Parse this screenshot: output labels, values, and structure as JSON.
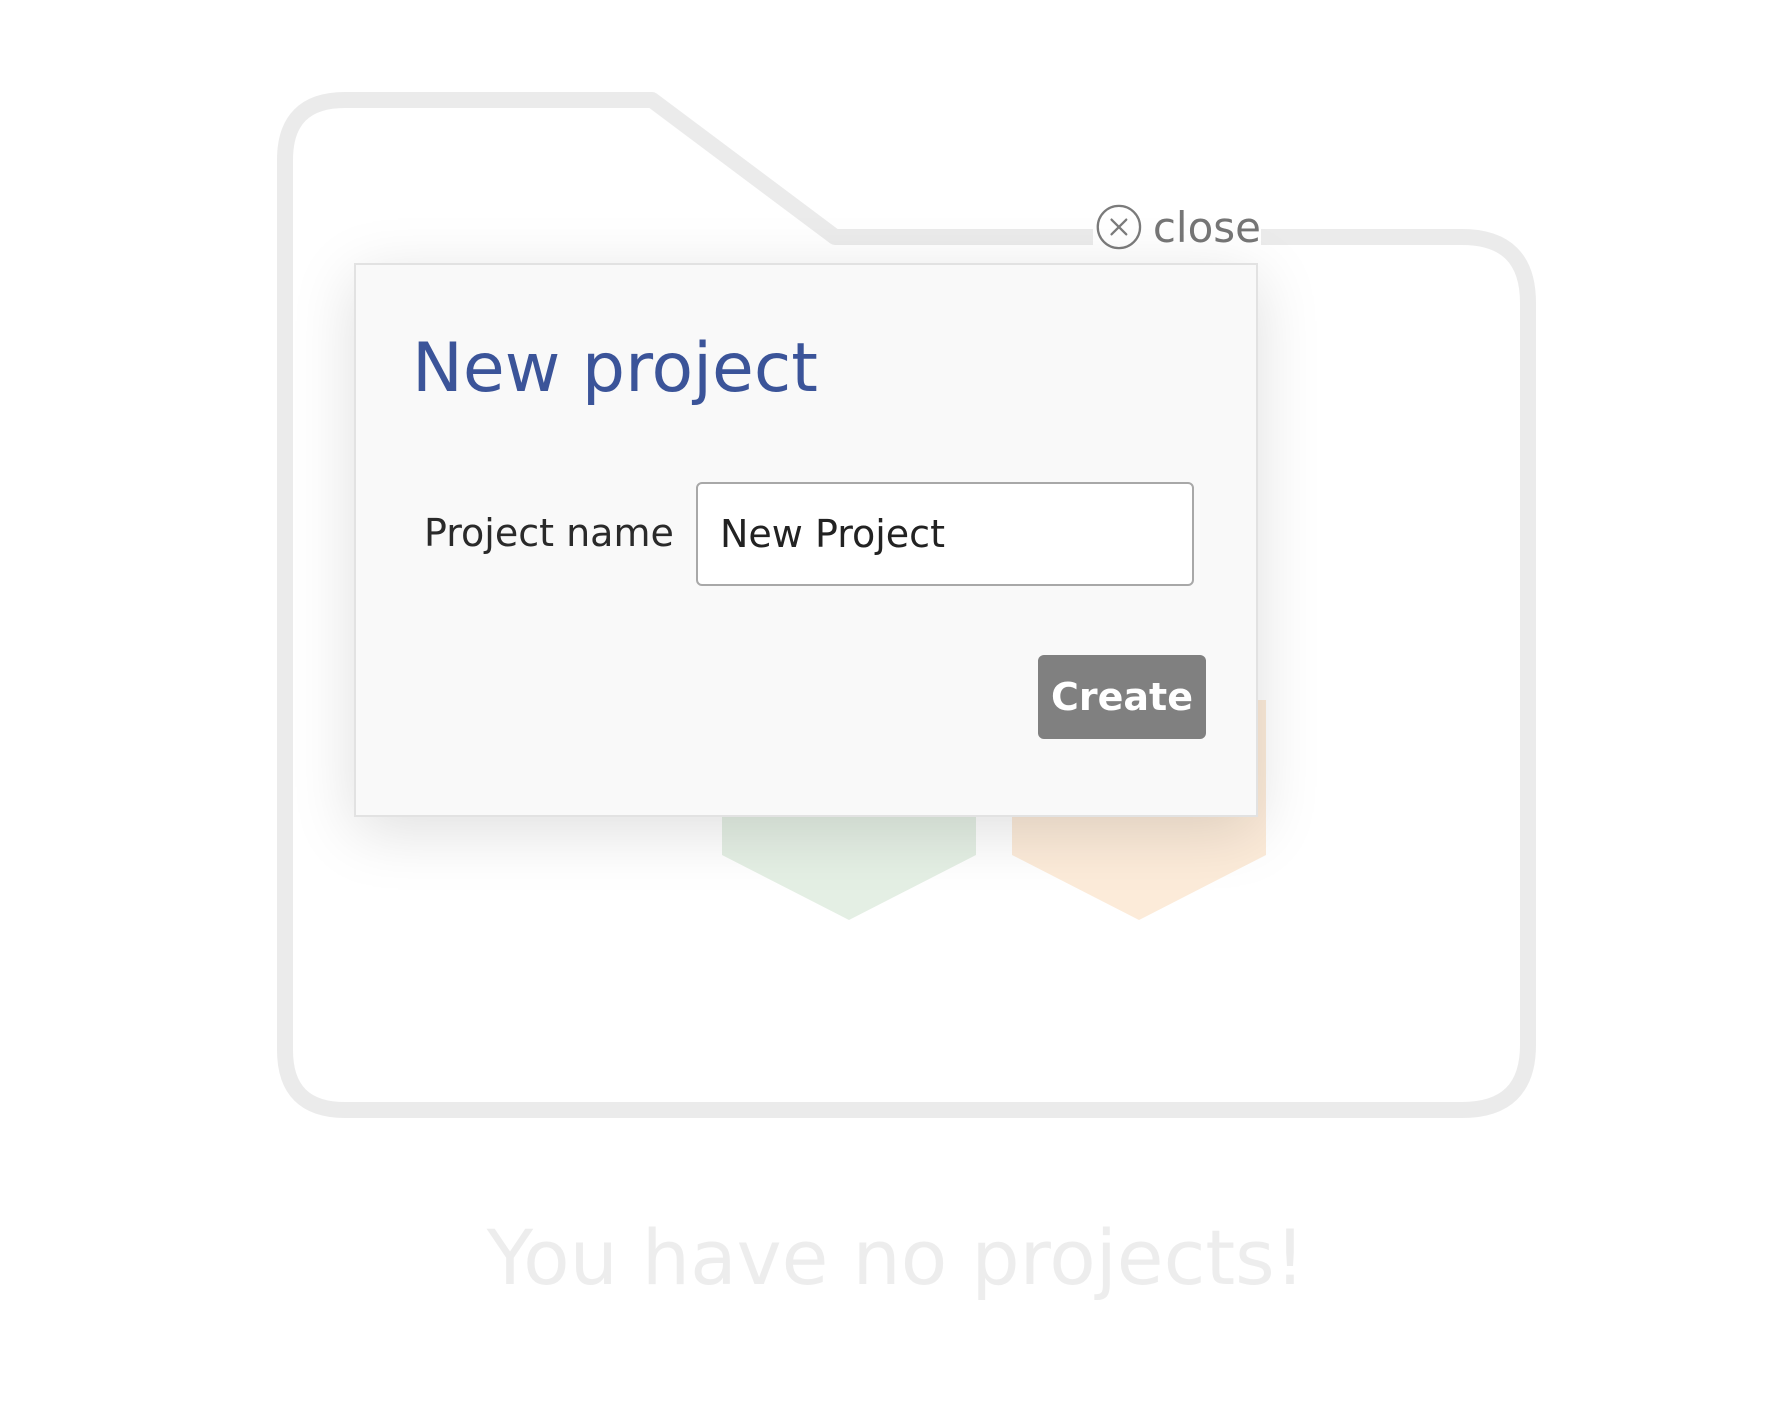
{
  "background": {
    "empty_message": "You have no projects!"
  },
  "dialog": {
    "close_label": "close",
    "title": "New project",
    "field_label": "Project name",
    "field_value": "New Project",
    "create_label": "Create"
  },
  "icons": {
    "close": "circled-x-icon",
    "folder": "folder-outline-icon",
    "arrows": "pentagon-arrow-icon"
  },
  "colors": {
    "title": "#3b5499",
    "create_button": "#808080",
    "arrow_green": "#e4efe4",
    "arrow_orange": "#fcebd9",
    "folder_outline": "#ebebeb"
  }
}
